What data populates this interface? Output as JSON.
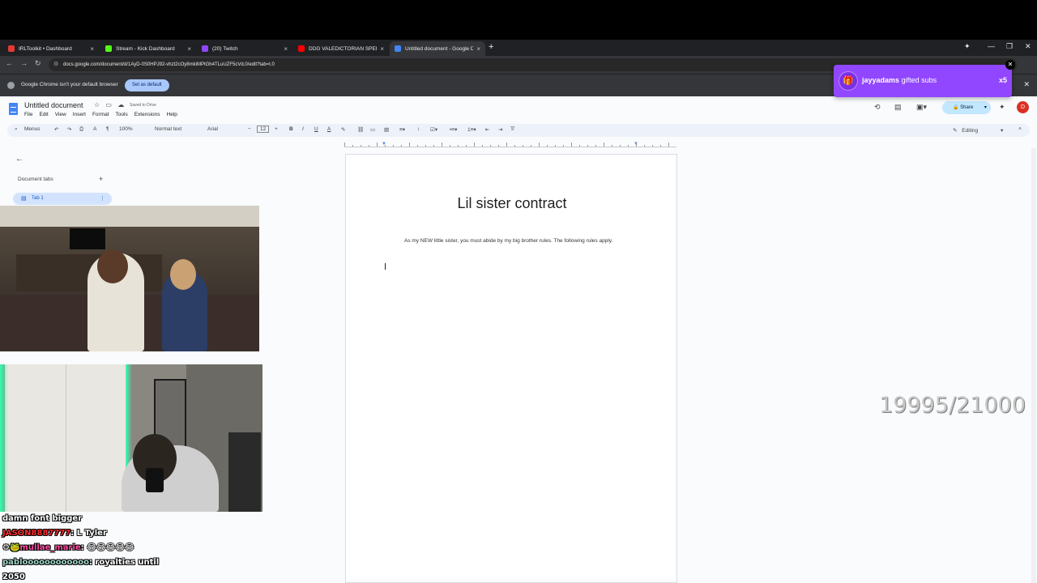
{
  "browser": {
    "tabs": [
      {
        "label": "IRLToolkit • Dashboard",
        "color": "#e53935",
        "active": false
      },
      {
        "label": "Stream - Kick Dashboard",
        "color": "#53fc18",
        "active": false
      },
      {
        "label": "(20) Twitch",
        "color": "#9146ff",
        "active": false
      },
      {
        "label": "DDG VALEDICTORIAN SPEECH",
        "color": "#ff0000",
        "active": false
      },
      {
        "label": "Untitled document - Google Do",
        "color": "#4285f4",
        "active": true
      }
    ],
    "url": "docs.google.com/document/d/1AyD-0S0HPJ92-vhzt2cOy8mkiMPtGh4TLuUZF5cVd,0/edit?tab=t.0",
    "infobar_message": "Google Chrome isn't your default browser",
    "infobar_button": "Set as default"
  },
  "docs": {
    "title": "Untitled document",
    "saved_status": "Saved to Drive",
    "menu": [
      "File",
      "Edit",
      "View",
      "Insert",
      "Format",
      "Tools",
      "Extensions",
      "Help"
    ],
    "share_label": "Share",
    "avatar_letter": "D",
    "toolbar": {
      "menus": "Menus",
      "zoom": "100%",
      "style": "Normal text",
      "font": "Arial",
      "font_size": "12"
    },
    "mode": "Editing",
    "sidebar": {
      "heading": "Document tabs",
      "tab_label": "Tab 1"
    },
    "heading": "Lil sister contract",
    "body": "As my NEW little sister, you must abide by my big brother rules. The following rules apply."
  },
  "overlay": {
    "counter": "19995/21000",
    "gift": {
      "user": "jayyadams",
      "text": "gifted subs",
      "count": "x5"
    },
    "chat": [
      {
        "user": "",
        "user_color": "#ffffff",
        "text": "damn font bigger"
      },
      {
        "user": "JASON8887777",
        "user_color": "#ff2a2a",
        "text": ": L Tyler"
      },
      {
        "user": "mullae_marie",
        "user_color": "#ff4fa3",
        "text": ": 😂😂😂😂😂"
      },
      {
        "user": "pabloooooooooooo",
        "user_color": "#9fd8c7",
        "text": ": royalties until"
      },
      {
        "user": "",
        "user_color": "#ffffff",
        "text": "2050"
      }
    ]
  }
}
